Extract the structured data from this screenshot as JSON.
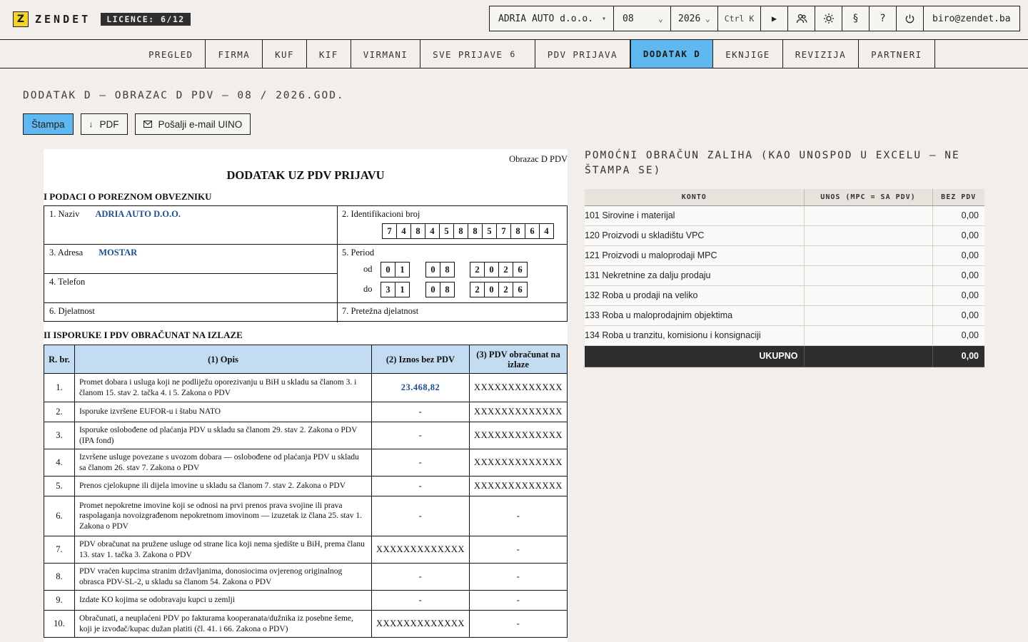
{
  "app": {
    "logo_letter": "Z",
    "name": "ZENDET",
    "licence": "LICENCE: 6/12"
  },
  "controls": {
    "company": "ADRIA AUTO d.o.o.",
    "month": "08",
    "year": "2026",
    "shortcut": "Ctrl K",
    "user_email": "biro@zendet.ba",
    "icons": [
      "play-icon",
      "users-icon",
      "sun-icon",
      "section-icon",
      "help-icon",
      "power-icon"
    ],
    "icon_glyphs": [
      "▶",
      "👥",
      "☼",
      "§",
      "?",
      "⏻"
    ]
  },
  "tabs": [
    {
      "label": "PREGLED",
      "count": ""
    },
    {
      "label": "FIRMA",
      "count": ""
    },
    {
      "label": "KUF",
      "count": ""
    },
    {
      "label": "KIF",
      "count": ""
    },
    {
      "label": "VIRMANI",
      "count": ""
    },
    {
      "label": "SVE PRIJAVE",
      "count": "6"
    },
    {
      "label": "PDV PRIJAVA",
      "count": ""
    },
    {
      "label": "DODATAK D",
      "count": "",
      "active": true
    },
    {
      "label": "EKNJIGE",
      "count": ""
    },
    {
      "label": "REVIZIJA",
      "count": ""
    },
    {
      "label": "PARTNERI",
      "count": ""
    }
  ],
  "page": {
    "title": "DODATAK D — OBRAZAC D PDV — 08 / 2026.GOD.",
    "print_label": "Štampa",
    "pdf_label": "PDF",
    "email_label": "Pošalji e-mail UINO"
  },
  "form": {
    "form_name": "Obrazac D PDV",
    "title": "DODATAK UZ PDV PRIJAVU",
    "section1_title": "I PODACI O POREZNOM OBVEZNIKU",
    "name_label": "1. Naziv",
    "name_value": "ADRIA AUTO D.O.O.",
    "id_label": "2. Identifikacioni broj",
    "id_digits": [
      "7",
      "4",
      "8",
      "4",
      "5",
      "8",
      "8",
      "5",
      "7",
      "8",
      "6",
      "4"
    ],
    "address_label": "3. Adresa",
    "address_value": "MOSTAR",
    "phone_label": "4. Telefon",
    "period_label": "5. Period",
    "from_label": "od",
    "to_label": "do",
    "from_day": [
      "0",
      "1"
    ],
    "from_month": [
      "0",
      "8"
    ],
    "from_year": [
      "2",
      "0",
      "2",
      "6"
    ],
    "to_day": [
      "3",
      "1"
    ],
    "to_month": [
      "0",
      "8"
    ],
    "to_year": [
      "2",
      "0",
      "2",
      "6"
    ],
    "activity_label": "6. Djelatnost",
    "main_activity_label": "7. Pretežna djelatnost",
    "section2_title": "II ISPORUKE I PDV OBRAČUNAT NA IZLAZE",
    "headers": [
      "R. br.",
      "(1) Opis",
      "(2) Iznos bez PDV",
      "(3) PDV obračunat na izlaze"
    ],
    "rows": [
      {
        "no": "1.",
        "desc": "Promet dobara i usluga koji ne podliježu oporezivanju u BiH u skladu sa članom 3. i članom 15. stav 2. tačka 4. i 5. Zakona o PDV",
        "amount": "23.468,82",
        "vat": "XXXXXXXXXXXXX",
        "amt_value": true
      },
      {
        "no": "2.",
        "desc": "Isporuke izvršene EUFOR-u i štabu NATO",
        "amount": "-",
        "vat": "XXXXXXXXXXXXX"
      },
      {
        "no": "3.",
        "desc": "Isporuke oslobođene od plaćanja PDV u skladu sa članom 29. stav 2. Zakona o PDV (IPA fond)",
        "amount": "-",
        "vat": "XXXXXXXXXXXXX"
      },
      {
        "no": "4.",
        "desc": "Izvršene usluge povezane s uvozom dobara — oslobođene od plaćanja PDV u skladu sa članom 26. stav 7. Zakona o PDV",
        "amount": "-",
        "vat": "XXXXXXXXXXXXX"
      },
      {
        "no": "5.",
        "desc": "Prenos cjelokupne ili dijela imovine u skladu sa članom 7. stav 2. Zakona o PDV",
        "amount": "-",
        "vat": "XXXXXXXXXXXXX"
      },
      {
        "no": "6.",
        "desc": "Promet nepokretne imovine koji se odnosi na prvi prenos prava svojine ili prava raspolaganja novoizgrađenom nepokretnom imovinom — izuzetak iz člana 25. stav 1. Zakona o PDV",
        "amount": "-",
        "vat": "-"
      },
      {
        "no": "7.",
        "desc": "PDV obračunat na pružene usluge od strane lica koji nema sjedište u BiH, prema članu 13. stav 1. tačka 3. Zakona o PDV",
        "amount": "XXXXXXXXXXXXX",
        "vat": "-"
      },
      {
        "no": "8.",
        "desc": "PDV vraćen kupcima stranim državljanima, donosiocima ovjerenog originalnog obrasca PDV-SL-2, u skladu sa članom 54. Zakona o PDV",
        "amount": "-",
        "vat": "-"
      },
      {
        "no": "9.",
        "desc": "Izdate KO kojima se odobravaju kupci u zemlji",
        "amount": "-",
        "vat": "-"
      },
      {
        "no": "10.",
        "desc": "Obračunati, a neuplaćeni PDV po fakturama kooperanata/dužnika iz posebne šeme, koji je izvođač/kupac dužan platiti (čl. 41. i 66. Zakona o PDV)",
        "amount": "XXXXXXXXXXXXX",
        "vat": "-"
      }
    ]
  },
  "aux": {
    "title": "POMOĆNI OBRAČUN ZALIHA (KAO UNOSPOD U EXCELU — NE ŠTAMPA SE)",
    "headers": [
      "KONTO",
      "UNOS (MPC = SA PDV)",
      "BEZ PDV"
    ],
    "rows": [
      {
        "konto": "101 Sirovine i materijal",
        "unos": "",
        "bez": "0,00"
      },
      {
        "konto": "120 Proizvodi u skladištu VPC",
        "unos": "",
        "bez": "0,00"
      },
      {
        "konto": "121 Proizvodi u maloprodaji MPC",
        "unos": "",
        "bez": "0,00"
      },
      {
        "konto": "131 Nekretnine za dalju prodaju",
        "unos": "",
        "bez": "0,00"
      },
      {
        "konto": "132 Roba u prodaji na veliko",
        "unos": "",
        "bez": "0,00"
      },
      {
        "konto": "133 Roba u maloprodajnim objektima",
        "unos": "",
        "bez": "0,00"
      },
      {
        "konto": "134 Roba u tranzitu, komisionu i konsignaciji",
        "unos": "",
        "bez": "0,00"
      }
    ],
    "total_label": "UKUPNO",
    "total_unos": "",
    "total_value": "0,00"
  }
}
